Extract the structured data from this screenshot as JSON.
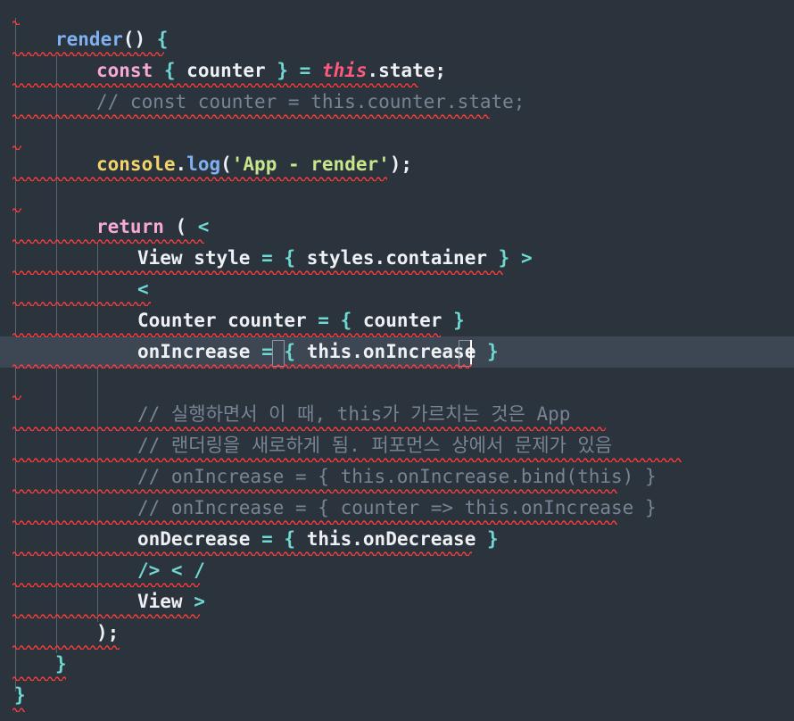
{
  "editor": {
    "language": "javascript",
    "lines": [
      {
        "tokens": [
          {
            "t": "render",
            "c": "fn"
          },
          {
            "t": "() ",
            "c": "punc"
          },
          {
            "t": "{",
            "c": "brace"
          }
        ]
      },
      {
        "tokens": [
          {
            "t": "const",
            "c": "kw"
          },
          {
            "t": " ",
            "c": "punc"
          },
          {
            "t": "{",
            "c": "brace"
          },
          {
            "t": " counter ",
            "c": "id"
          },
          {
            "t": "}",
            "c": "brace"
          },
          {
            "t": " = ",
            "c": "op"
          },
          {
            "t": "this",
            "c": "this"
          },
          {
            "t": ".state;",
            "c": "id"
          }
        ]
      },
      {
        "tokens": [
          {
            "t": "// const counter = this.counter.state;",
            "c": "com"
          }
        ]
      },
      {
        "tokens": []
      },
      {
        "tokens": [
          {
            "t": "console",
            "c": "cls"
          },
          {
            "t": ".",
            "c": "punc"
          },
          {
            "t": "log",
            "c": "fn"
          },
          {
            "t": "(",
            "c": "punc"
          },
          {
            "t": "'App - render'",
            "c": "str"
          },
          {
            "t": ");",
            "c": "punc"
          }
        ]
      },
      {
        "tokens": []
      },
      {
        "tokens": [
          {
            "t": "return",
            "c": "kw"
          },
          {
            "t": " ( ",
            "c": "punc"
          },
          {
            "t": "<",
            "c": "op"
          }
        ]
      },
      {
        "tokens": [
          {
            "t": "View style ",
            "c": "id"
          },
          {
            "t": "=",
            "c": "op"
          },
          {
            "t": " ",
            "c": "punc"
          },
          {
            "t": "{",
            "c": "brace"
          },
          {
            "t": " styles.container ",
            "c": "id"
          },
          {
            "t": "}",
            "c": "brace"
          },
          {
            "t": " ",
            "c": "punc"
          },
          {
            "t": ">",
            "c": "op"
          }
        ]
      },
      {
        "tokens": [
          {
            "t": "<",
            "c": "op"
          }
        ]
      },
      {
        "tokens": [
          {
            "t": "Counter counter ",
            "c": "id"
          },
          {
            "t": "=",
            "c": "op"
          },
          {
            "t": " ",
            "c": "punc"
          },
          {
            "t": "{",
            "c": "brace"
          },
          {
            "t": " counter ",
            "c": "id"
          },
          {
            "t": "}",
            "c": "brace"
          }
        ]
      },
      {
        "tokens": [
          {
            "t": "onIncrease ",
            "c": "id"
          },
          {
            "t": "=",
            "c": "op"
          },
          {
            "t": " ",
            "c": "punc"
          },
          {
            "t": "{",
            "c": "brace"
          },
          {
            "t": " this.onIncrease ",
            "c": "id"
          },
          {
            "t": "}",
            "c": "brace"
          }
        ]
      },
      {
        "tokens": []
      },
      {
        "tokens": [
          {
            "t": "// 실행하면서 이 때, this가 가르치는 것은 App",
            "c": "com"
          }
        ]
      },
      {
        "tokens": [
          {
            "t": "// 랜더링을 새로하게 됨. 퍼포먼스 상에서 문제가 있음",
            "c": "com"
          }
        ]
      },
      {
        "tokens": [
          {
            "t": "// onIncrease = { this.onIncrease.bind(this) }",
            "c": "com"
          }
        ]
      },
      {
        "tokens": [
          {
            "t": "// onIncrease = { counter => this.onIncrease }",
            "c": "com"
          }
        ]
      },
      {
        "tokens": [
          {
            "t": "onDecrease ",
            "c": "id"
          },
          {
            "t": "=",
            "c": "op"
          },
          {
            "t": " ",
            "c": "punc"
          },
          {
            "t": "{",
            "c": "brace"
          },
          {
            "t": " this.onDecrease ",
            "c": "id"
          },
          {
            "t": "}",
            "c": "brace"
          }
        ]
      },
      {
        "tokens": [
          {
            "t": "/> < /",
            "c": "op"
          }
        ]
      },
      {
        "tokens": [
          {
            "t": "View ",
            "c": "id"
          },
          {
            "t": ">",
            "c": "op"
          }
        ]
      },
      {
        "tokens": [
          {
            "t": ");",
            "c": "punc"
          }
        ]
      },
      {
        "tokens": [
          {
            "t": "}",
            "c": "brace"
          }
        ]
      },
      {
        "tokens": [
          {
            "t": "}",
            "c": "brace"
          }
        ]
      }
    ]
  },
  "colors": {
    "background": "#2b333d",
    "active_line": "#3d4653",
    "error_squiggle": "#ff3b3b",
    "keyword": "#f7a8d4",
    "this_keyword": "#ff5a7e",
    "operator": "#6ed8d1",
    "function": "#7fb1f0",
    "string": "#c7e58a",
    "class": "#f2d46a",
    "comment": "#778494"
  }
}
